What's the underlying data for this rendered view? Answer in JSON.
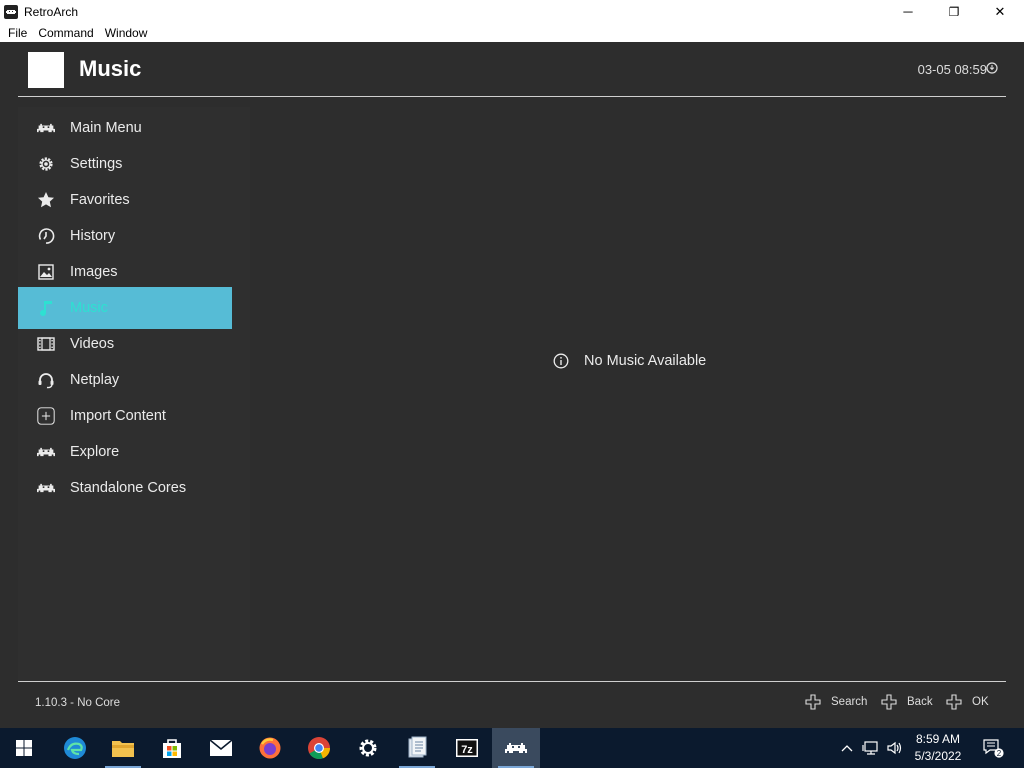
{
  "window": {
    "title": "RetroArch",
    "minimize_glyph": "─",
    "maximize_glyph": "❐",
    "close_glyph": "✕"
  },
  "menubar": [
    "File",
    "Command",
    "Window"
  ],
  "header": {
    "title": "Music",
    "clock": "03-05 08:59"
  },
  "sidebar": {
    "items": [
      {
        "label": "Main Menu",
        "icon": "retroarch-invader-icon"
      },
      {
        "label": "Settings",
        "icon": "gear-icon"
      },
      {
        "label": "Favorites",
        "icon": "star-icon"
      },
      {
        "label": "History",
        "icon": "history-clock-icon"
      },
      {
        "label": "Images",
        "icon": "image-icon"
      },
      {
        "label": "Music",
        "icon": "music-note-icon",
        "active": true
      },
      {
        "label": "Videos",
        "icon": "film-icon"
      },
      {
        "label": "Netplay",
        "icon": "headset-icon"
      },
      {
        "label": "Import Content",
        "icon": "plus-icon"
      },
      {
        "label": "Explore",
        "icon": "retroarch-invader-icon"
      },
      {
        "label": "Standalone Cores",
        "icon": "retroarch-invader-icon"
      }
    ]
  },
  "content": {
    "empty_message": "No Music Available"
  },
  "footer": {
    "version": "1.10.3 - No Core",
    "actions": [
      {
        "label": "Search",
        "icon": "dpad-icon"
      },
      {
        "label": "Back",
        "icon": "dpad-icon"
      },
      {
        "label": "OK",
        "icon": "dpad-icon"
      }
    ]
  },
  "taskbar": {
    "apps": [
      "start",
      "edge",
      "file-explorer",
      "store",
      "mail",
      "firefox",
      "chrome",
      "settings",
      "notepad",
      "7zip",
      "retroarch"
    ],
    "time": "8:59 AM",
    "date": "5/3/2022",
    "notification_count": "2"
  },
  "colors": {
    "background": "#2d2d2d",
    "accent": "#56bcd6",
    "active_text": "#2ee0d2",
    "taskbar": "#0b1a2e"
  }
}
